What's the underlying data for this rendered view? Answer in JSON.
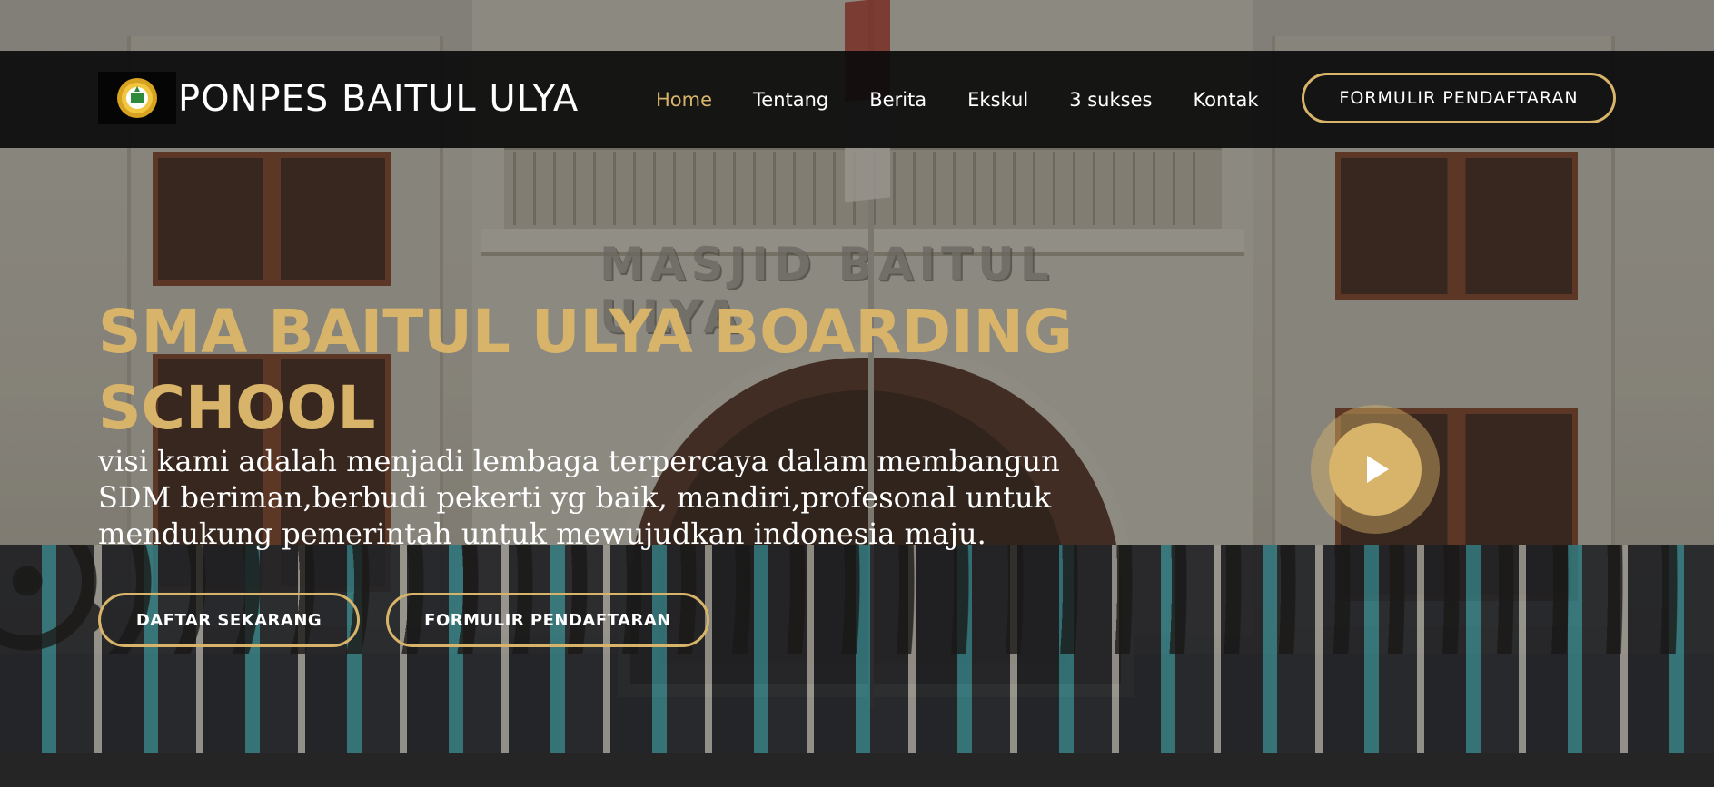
{
  "header": {
    "brand": "PONPES BAITUL ULYA",
    "nav": [
      {
        "label": "Home",
        "active": true
      },
      {
        "label": "Tentang",
        "active": false
      },
      {
        "label": "Berita",
        "active": false
      },
      {
        "label": "Ekskul",
        "active": false
      },
      {
        "label": "3 sukses",
        "active": false
      },
      {
        "label": "Kontak",
        "active": false
      }
    ],
    "cta_label": "FORMULIR PENDAFTARAN"
  },
  "hero": {
    "title": "SMA BAITUL ULYA BOARDING SCHOOL",
    "subtitle": "visi kami adalah menjadi lembaga terpercaya dalam membangun SDM beriman,berbudi pekerti yg baik, mandiri,profesonal untuk mendukung pemerintah untuk mewujudkan indonesia maju.",
    "buttons": {
      "daftar": "DAFTAR SEKARANG",
      "formulir": "FORMULIR PENDAFTARAN"
    },
    "background_text": "MASJID BAITUL ULYA"
  },
  "colors": {
    "accent": "#d8b46a",
    "navbar_bg": "#0c0c0c",
    "text": "#ffffff"
  },
  "icons": {
    "logo": "school-seal-icon",
    "play": "play-icon"
  }
}
